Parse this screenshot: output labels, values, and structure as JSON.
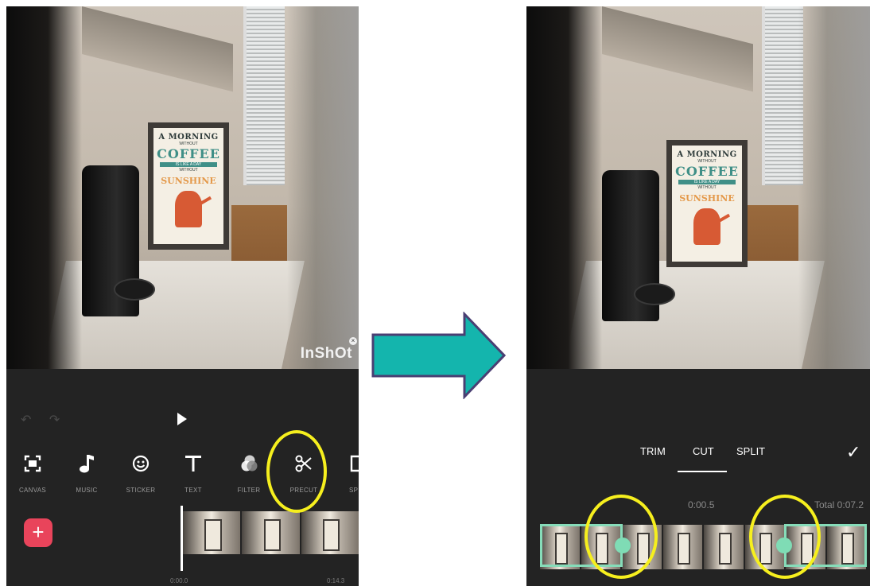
{
  "before": {
    "watermark": "InShOt",
    "poster": {
      "line1": "A MORNING",
      "line2": "WITHOUT",
      "line3": "COFFEE",
      "line4": "IS LIKE A DAY",
      "line5": "WITHOUT",
      "line6": "SUNSHINE"
    },
    "tools": [
      {
        "label": "CANVAS",
        "icon": "canvas-icon"
      },
      {
        "label": "MUSIC",
        "icon": "music-note-icon"
      },
      {
        "label": "STICKER",
        "icon": "smiley-icon"
      },
      {
        "label": "TEXT",
        "icon": "text-icon"
      },
      {
        "label": "FILTER",
        "icon": "filter-icon"
      },
      {
        "label": "PRECUT",
        "icon": "scissors-icon"
      },
      {
        "label": "SP",
        "icon": "speed-icon"
      }
    ],
    "add_label": "+",
    "timeline": {
      "start": "0:00.0",
      "end": "0:14.3"
    }
  },
  "after": {
    "poster": {
      "line1": "A MORNING",
      "line2": "WITHOUT",
      "line3": "COFFEE",
      "line4": "IS LIKE A DAY",
      "line5": "WITHOUT",
      "line6": "SUNSHINE"
    },
    "modes": [
      "TRIM",
      "CUT",
      "SPLIT"
    ],
    "selected_mode": "CUT",
    "confirm": "✓",
    "current_time": "0:00.5",
    "total": "Total 0:07.2"
  },
  "colors": {
    "accent_green": "#7fdcb5",
    "highlight_yellow": "#f6ef1e",
    "arrow_teal": "#14b5ad",
    "add_red": "#e9445b"
  }
}
